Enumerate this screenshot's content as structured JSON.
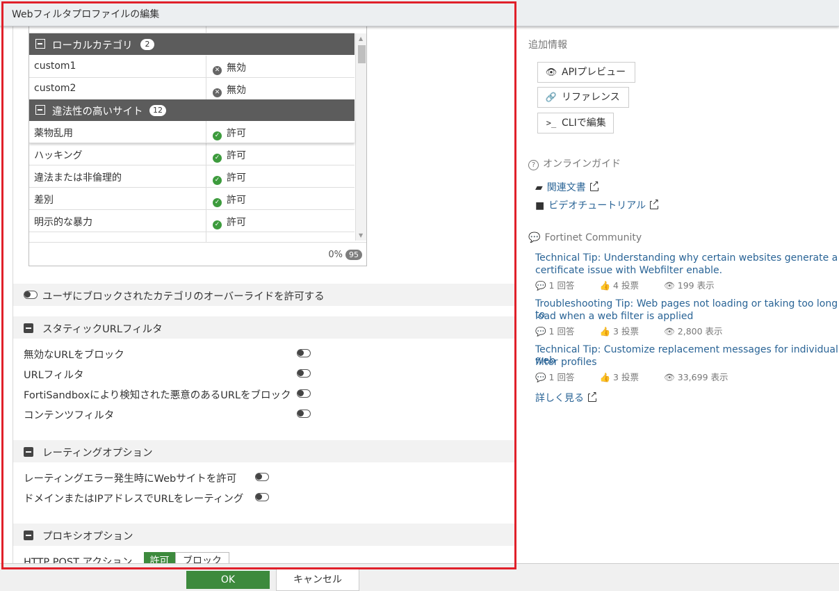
{
  "window": {
    "title": "Webフィルタプロファイルの編集"
  },
  "category_table": {
    "groups": [
      {
        "label": "ローカルカテゴリ",
        "count": "2"
      },
      {
        "label": "違法性の高いサイト",
        "count": "12"
      }
    ],
    "rows": [
      {
        "name": "custom1",
        "action": "無効",
        "status": "disabled"
      },
      {
        "name": "custom2",
        "action": "無効",
        "status": "disabled"
      },
      {
        "name": "薬物乱用",
        "action": "許可",
        "status": "allow"
      },
      {
        "name": "ハッキング",
        "action": "許可",
        "status": "allow"
      },
      {
        "name": "違法または非倫理的",
        "action": "許可",
        "status": "allow"
      },
      {
        "name": "差別",
        "action": "許可",
        "status": "allow"
      },
      {
        "name": "明示的な暴力",
        "action": "許可",
        "status": "allow"
      }
    ],
    "footer_percent": "0%",
    "footer_count": "95"
  },
  "override": {
    "label": "ユーザにブロックされたカテゴリのオーバーライドを許可する",
    "enabled": false
  },
  "static_url": {
    "header": "スタティックURLフィルタ",
    "options": [
      {
        "label": "無効なURLをブロック",
        "enabled": false
      },
      {
        "label": "URLフィルタ",
        "enabled": false
      },
      {
        "label": "FortiSandboxにより検知された悪意のあるURLをブロック",
        "enabled": false
      },
      {
        "label": "コンテンツフィルタ",
        "enabled": false
      }
    ]
  },
  "rating": {
    "header": "レーティングオプション",
    "options": [
      {
        "label": "レーティングエラー発生時にWebサイトを許可",
        "enabled": false
      },
      {
        "label": "ドメインまたはIPアドレスでURLをレーティング",
        "enabled": false
      }
    ]
  },
  "proxy": {
    "header": "プロキシオプション",
    "http_post_label": "HTTP POST アクション",
    "allow_label": "許可",
    "block_label": "ブロック",
    "selected": "許可"
  },
  "footer": {
    "ok_label": "OK",
    "cancel_label": "キャンセル"
  },
  "side": {
    "additional_info": "追加情報",
    "api_preview": "APIプレビュー",
    "reference": "リファレンス",
    "cli_edit": "CLIで編集",
    "online_guide": "オンラインガイド",
    "related_docs": "関連文書",
    "video_tutorial": "ビデオチュートリアル",
    "community": "Fortinet Community",
    "articles": [
      {
        "title_line1": "Technical Tip: Understanding why certain websites generate a",
        "title_line2": "certificate issue with Webfilter enable.",
        "answers": "1 回答",
        "votes": "4 投票",
        "views": "199 表示"
      },
      {
        "title_line1": "Troubleshooting Tip: Web pages not loading or taking too long to",
        "title_line2": "load when a web filter is applied",
        "answers": "1 回答",
        "votes": "3 投票",
        "views": "2,800 表示"
      },
      {
        "title_line1": "Technical Tip: Customize replacement messages for individual web",
        "title_line2": "filter profiles",
        "answers": "1 回答",
        "votes": "3 投票",
        "views": "33,699 表示"
      }
    ],
    "see_more": "詳しく見る"
  },
  "colors": {
    "accent_green": "#3d8a3d",
    "allow_green": "#3d9b3d",
    "link_blue": "#2a6496",
    "highlight_red": "#e0202a"
  }
}
